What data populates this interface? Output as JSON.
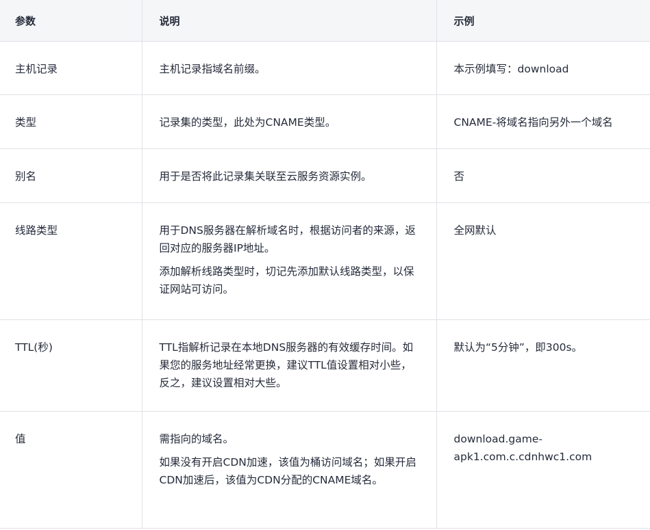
{
  "headers": [
    "参数",
    "说明",
    "示例"
  ],
  "rows": [
    {
      "param": "主机记录",
      "desc": [
        "主机记录指域名前缀。"
      ],
      "example": "本示例填写：download"
    },
    {
      "param": "类型",
      "desc": [
        "记录集的类型，此处为CNAME类型。"
      ],
      "example": "CNAME-将域名指向另外一个域名"
    },
    {
      "param": "别名",
      "desc": [
        "用于是否将此记录集关联至云服务资源实例。"
      ],
      "example": "否"
    },
    {
      "param": "线路类型",
      "desc": [
        "用于DNS服务器在解析域名时，根据访问者的来源，返回对应的服务器IP地址。",
        "添加解析线路类型时，切记先添加默认线路类型，以保证网站可访问。"
      ],
      "example": "全网默认"
    },
    {
      "param": "TTL(秒)",
      "desc": [
        "TTL指解析记录在本地DNS服务器的有效缓存时间。如果您的服务地址经常更换，建议TTL值设置相对小些，反之，建议设置相对大些。"
      ],
      "example": "默认为“5分钟”，即300s。"
    },
    {
      "param": "值",
      "desc": [
        "需指向的域名。",
        "如果没有开启CDN加速，该值为桶访问域名；如果开启CDN加速后，该值为CDN分配的CNAME域名。"
      ],
      "example": "download.game-apk1.com.c.cdnhwc1.com"
    }
  ]
}
